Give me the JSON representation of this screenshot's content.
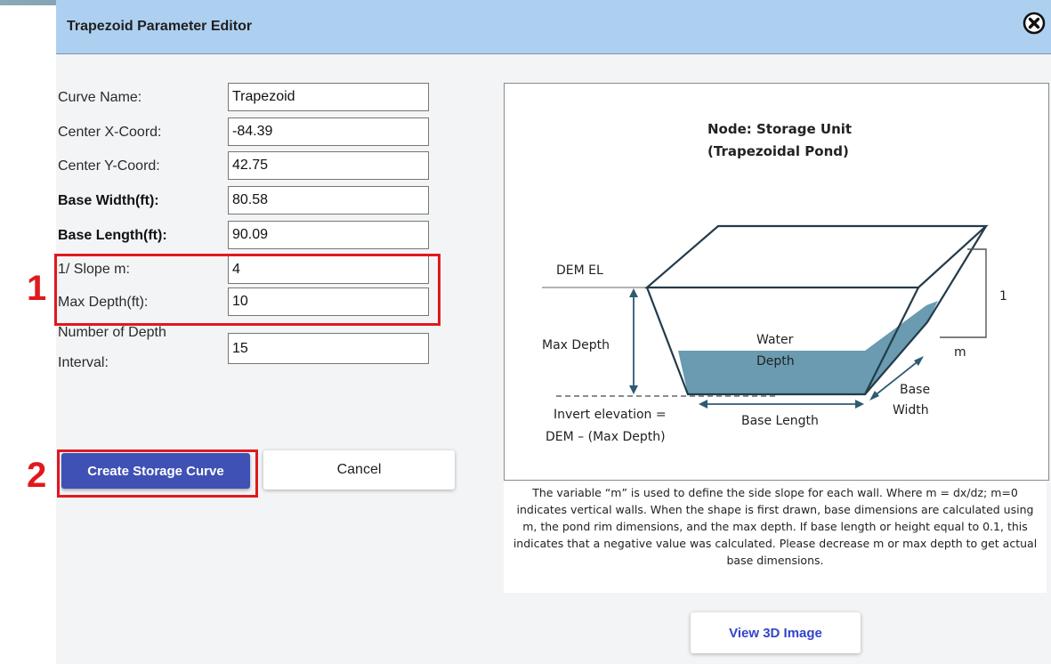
{
  "dialog": {
    "title": "Trapezoid Parameter Editor"
  },
  "fields": [
    {
      "label": "Curve Name:",
      "value": "Trapezoid",
      "bold": false
    },
    {
      "label": "Center X-Coord:",
      "value": "-84.39",
      "bold": false
    },
    {
      "label": "Center Y-Coord:",
      "value": "42.75",
      "bold": false
    },
    {
      "label": "Base Width(ft):",
      "value": "80.58",
      "bold": true
    },
    {
      "label": "Base Length(ft):",
      "value": "90.09",
      "bold": true
    },
    {
      "label": "1/ Slope m:",
      "value": "4",
      "bold": false
    },
    {
      "label": "Max Depth(ft):",
      "value": "10",
      "bold": false
    },
    {
      "label_line1": "Number of Depth",
      "label_line2": "Interval:",
      "value": "15",
      "bold": false
    }
  ],
  "annotations": {
    "step1": "1",
    "step2": "2",
    "highlight_color": "#e0191e"
  },
  "buttons": {
    "create": "Create Storage Curve",
    "cancel": "Cancel",
    "view3d": "View 3D Image"
  },
  "diagram": {
    "title_line1": "Node: Storage Unit",
    "title_line2": "(Trapezoidal Pond)",
    "dem_el": "DEM EL",
    "max_depth": "Max Depth",
    "water": "Water",
    "depth": "Depth",
    "one": "1",
    "m": "m",
    "base": "Base",
    "width": "Width",
    "base_length": "Base Length",
    "invert_line1": "Invert elevation =",
    "invert_line2": "DEM – (Max Depth)",
    "water_color": "#6a9bb0"
  },
  "description": "The variable “m” is used to define the side slope for each wall.  Where m = dx/dz; m=0 indicates vertical walls. When the shape is first drawn, base dimensions are calculated using m, the pond rim dimensions, and the max depth. If base length or height equal to  0.1, this indicates that a negative value was calculated.  Please decrease m or max depth to get actual base dimensions.",
  "colors": {
    "header_bg": "#aed0f0",
    "primary_button": "#3f51b5",
    "link_text": "#3344cc"
  }
}
